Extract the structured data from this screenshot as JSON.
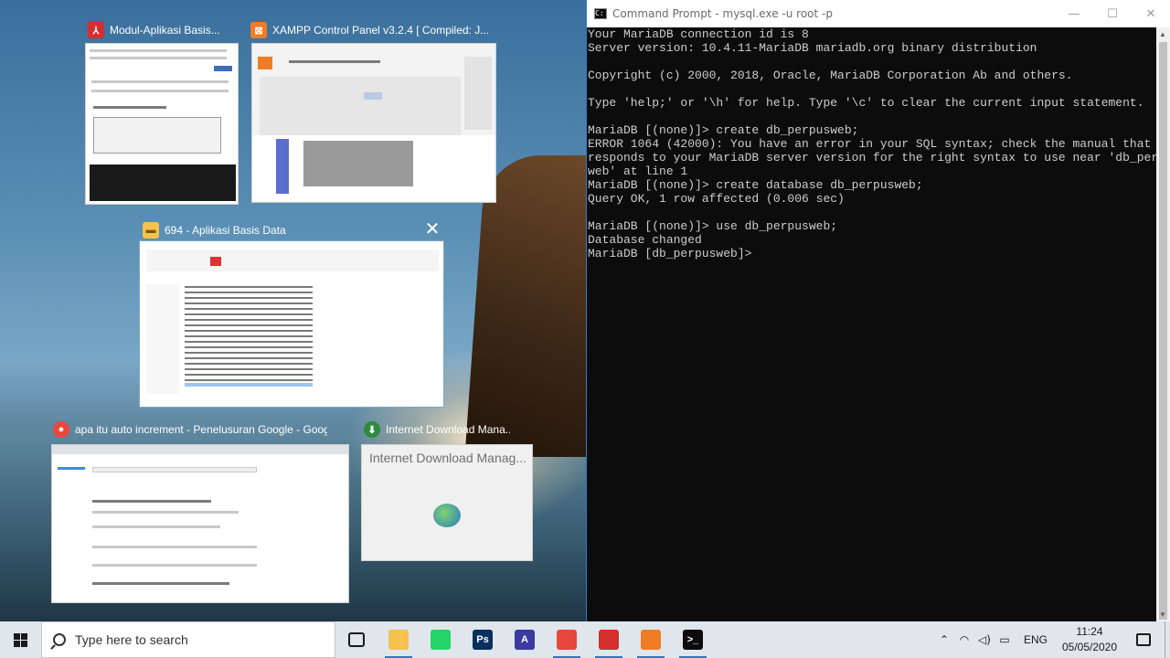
{
  "task_view": {
    "windows": [
      {
        "title": "Modul-Aplikasi Basis...",
        "icon": "pdf-icon",
        "color": "#d32f2f"
      },
      {
        "title": "XAMPP Control Panel v3.2.4   [ Compiled: J...",
        "icon": "xampp-icon",
        "color": "#f07c25"
      },
      {
        "title": "694 - Aplikasi Basis Data",
        "icon": "folder-icon",
        "color": "#f4c24d"
      },
      {
        "title": "apa itu auto increment - Penelusuran Google - Googl...",
        "icon": "chrome-icon",
        "color": "#e9473d"
      },
      {
        "title": "Internet Download Mana...",
        "icon": "idm-icon",
        "color": "#2f8a3a"
      }
    ],
    "idm_preview_text": "Internet Download Manag...",
    "close_symbol": "✕"
  },
  "cmd": {
    "title": "Command Prompt - mysql.exe  -u root -p",
    "minimize": "—",
    "maximize": "☐",
    "close": "✕",
    "lines": [
      "Your MariaDB connection id is 8",
      "Server version: 10.4.11-MariaDB mariadb.org binary distribution",
      "",
      "Copyright (c) 2000, 2018, Oracle, MariaDB Corporation Ab and others.",
      "",
      "Type 'help;' or '\\h' for help. Type '\\c' to clear the current input statement.",
      "",
      "MariaDB [(none)]> create db_perpusweb;",
      "ERROR 1064 (42000): You have an error in your SQL syntax; check the manual that cor",
      "responds to your MariaDB server version for the right syntax to use near 'db_perpus",
      "web' at line 1",
      "MariaDB [(none)]> create database db_perpusweb;",
      "Query OK, 1 row affected (0.006 sec)",
      "",
      "MariaDB [(none)]> use db_perpusweb;",
      "Database changed",
      "MariaDB [db_perpusweb]>"
    ]
  },
  "taskbar": {
    "search_placeholder": "Type here to search",
    "apps": [
      {
        "name": "task-view",
        "label": "",
        "color": "#1a1a1a",
        "active": false
      },
      {
        "name": "file-explorer",
        "label": "",
        "color": "#f4c24d",
        "active": true
      },
      {
        "name": "whatsapp",
        "label": "",
        "color": "#25d366",
        "active": false
      },
      {
        "name": "photoshop",
        "label": "Ps",
        "color": "#0a2f5c",
        "active": false
      },
      {
        "name": "app-a",
        "label": "A",
        "color": "#3a3aa0",
        "active": false
      },
      {
        "name": "chrome",
        "label": "",
        "color": "#e9473d",
        "active": true
      },
      {
        "name": "acrobat",
        "label": "",
        "color": "#d32f2f",
        "active": true
      },
      {
        "name": "xampp",
        "label": "",
        "color": "#f07c25",
        "active": true
      },
      {
        "name": "cmd",
        "label": ">_",
        "color": "#0c0c0c",
        "active": true
      }
    ],
    "language": "ENG",
    "time": "11:24",
    "date": "05/05/2020"
  }
}
